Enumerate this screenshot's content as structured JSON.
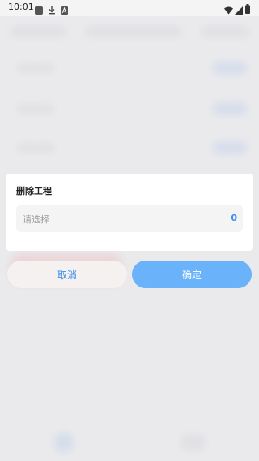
{
  "status_bar": {
    "time": "10:01",
    "left_icons": [
      "app-notification-icon",
      "download-icon",
      "text-a-icon"
    ],
    "right_icons": [
      "wifi-icon",
      "signal-icon",
      "battery-icon"
    ]
  },
  "dialog": {
    "title": "删除工程",
    "select": {
      "placeholder": "请选择",
      "count": "0"
    }
  },
  "buttons": {
    "cancel_label": "取消",
    "confirm_label": "确定"
  },
  "colors": {
    "accent": "#3b8fe8",
    "confirm_bg": "#6ab2f9",
    "cancel_bg": "#f5f1f0",
    "field_bg": "#f4f4f5"
  }
}
